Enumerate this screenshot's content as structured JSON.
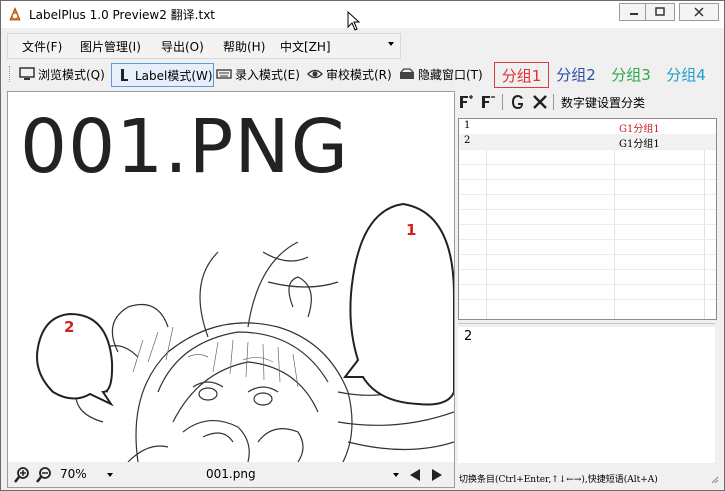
{
  "window": {
    "title": "LabelPlus 1.0 Preview2 翻译.txt",
    "icons": [
      "app-icon",
      "minimize-icon",
      "maximize-icon",
      "close-icon"
    ]
  },
  "menu": {
    "file": "文件(F)",
    "image": "图片管理(I)",
    "export": "导出(O)",
    "help": "帮助(H)",
    "language": "中文[ZH]"
  },
  "toolbar": {
    "browse": "浏览模式(Q)",
    "label": "Label模式(W)",
    "input": "录入模式(E)",
    "review": "审校模式(R)",
    "hide": "隐藏窗口(T)",
    "active_mode": "label",
    "groups": [
      {
        "label": "分组1",
        "color": "#e03030",
        "selected": true
      },
      {
        "label": "分组2",
        "color": "#2b4ea8",
        "selected": false
      },
      {
        "label": "分组3",
        "color": "#2ea84a",
        "selected": false
      },
      {
        "label": "分组4",
        "color": "#1f9fc8",
        "selected": false
      }
    ]
  },
  "canvas": {
    "title": "001.PNG",
    "markers": [
      "1",
      "2"
    ],
    "marker_color": "#d42020"
  },
  "bottom": {
    "zoom": "70%",
    "file": "001.png"
  },
  "right": {
    "toolbar_text": "数字键设置分类",
    "rows": [
      {
        "index": "1",
        "group": "G1分组1",
        "group_color": "#cc2020",
        "selected": true
      },
      {
        "index": "2",
        "group": "G1分组1",
        "group_color": "#000000",
        "selected": false
      }
    ],
    "current_index": "2",
    "hint": "切换条目(Ctrl+Enter,↑↓←→),快捷短语(Alt+A)"
  }
}
